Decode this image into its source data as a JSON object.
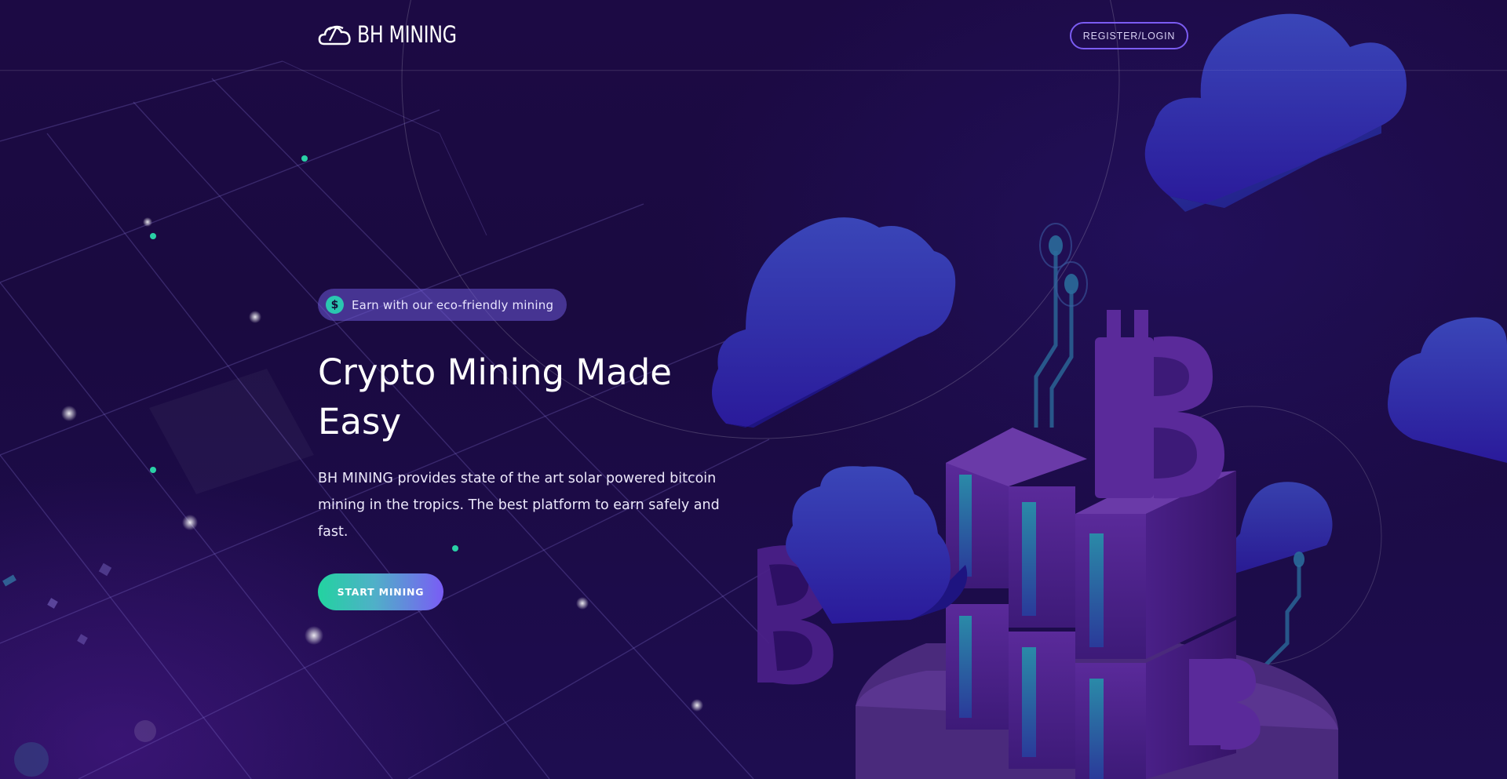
{
  "header": {
    "logo_text": "BH MINING",
    "register_label": "REGISTER/LOGIN"
  },
  "hero": {
    "badge_icon": "$",
    "badge_text": "Earn with our eco-friendly mining",
    "title": "Crypto Mining Made Easy",
    "description": "BH MINING provides state of the art solar powered bitcoin mining in the tropics. The best platform to earn safely and fast.",
    "cta_label": "START MINING"
  },
  "icons": {
    "logo": "cloud-pickaxe-icon",
    "badge": "dollar-icon"
  },
  "colors": {
    "background": "#1a0a3e",
    "accent_purple": "#7b5cf2",
    "accent_teal": "#22d3a0",
    "badge_bg": "#6c58d6"
  }
}
